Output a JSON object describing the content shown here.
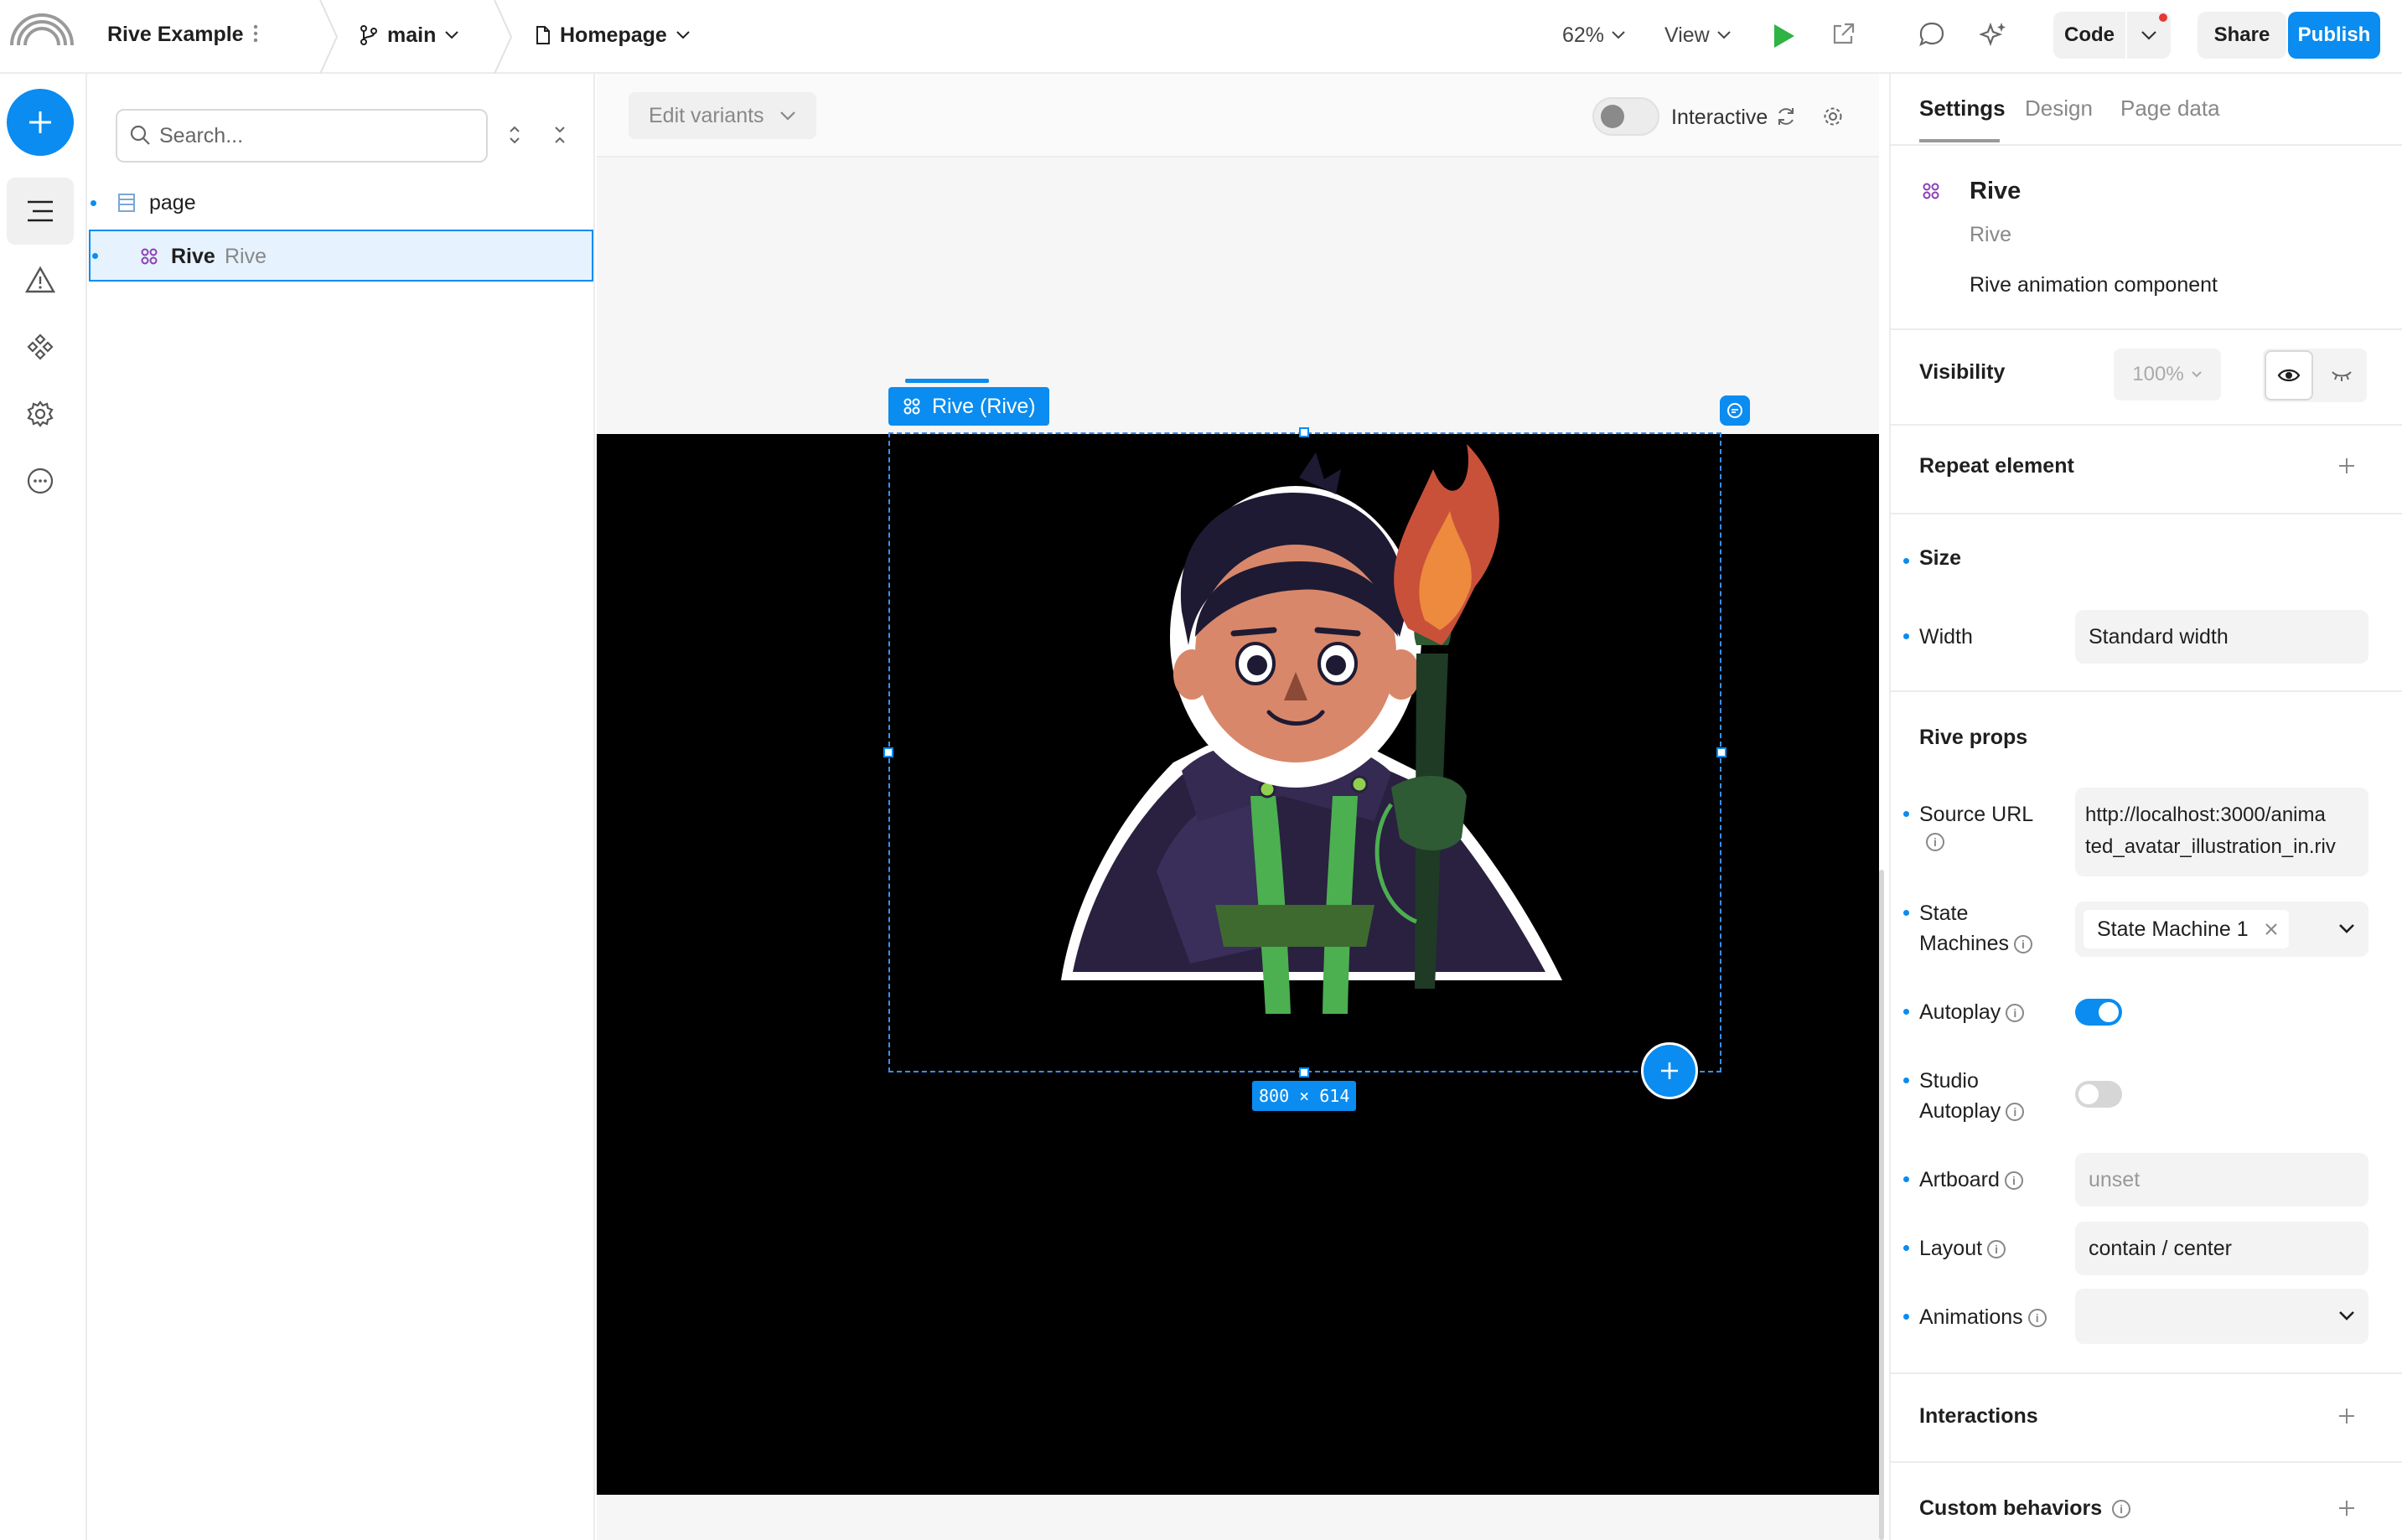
{
  "topbar": {
    "project_name": "Rive Example",
    "branch": "main",
    "page": "Homepage",
    "zoom": "62%",
    "view_label": "View",
    "code_label": "Code",
    "share_label": "Share",
    "publish_label": "Publish"
  },
  "layers": {
    "search_placeholder": "Search...",
    "items": [
      {
        "label": "page",
        "sub": ""
      },
      {
        "label": "Rive",
        "sub": "Rive"
      }
    ]
  },
  "canvas": {
    "edit_variants": "Edit variants",
    "interactive_label": "Interactive",
    "selection_label": "Rive (Rive)",
    "size_badge": "800 × 614"
  },
  "props": {
    "tabs": [
      "Settings",
      "Design",
      "Page data"
    ],
    "component": {
      "name": "Rive",
      "type": "Rive",
      "description": "Rive animation component"
    },
    "visibility": {
      "label": "Visibility",
      "opacity": "100%"
    },
    "repeat_label": "Repeat element",
    "size": {
      "title": "Size",
      "width_label": "Width",
      "width_value": "Standard width"
    },
    "rive_props": {
      "title": "Rive props",
      "source_url_label": "Source URL",
      "source_url_value": "http://localhost:3000/animated_avatar_illustration_in.riv",
      "source_url_line1": "http://localhost:3000/anima",
      "source_url_line2": "ted_avatar_illustration_in.riv",
      "state_machines_label_1": "State",
      "state_machines_label_2": "Machines",
      "state_machine_value": "State Machine 1",
      "autoplay_label": "Autoplay",
      "autoplay": true,
      "studio_autoplay_label_1": "Studio",
      "studio_autoplay_label_2": "Autoplay",
      "studio_autoplay": false,
      "artboard_label": "Artboard",
      "artboard_placeholder": "unset",
      "layout_label": "Layout",
      "layout_value": "contain / center",
      "animations_label": "Animations"
    },
    "interactions_label": "Interactions",
    "custom_behaviors_label": "Custom behaviors"
  },
  "colors": {
    "accent": "#0a8cf0",
    "canvas_frame": "#000000",
    "play_green": "#2fb344"
  }
}
